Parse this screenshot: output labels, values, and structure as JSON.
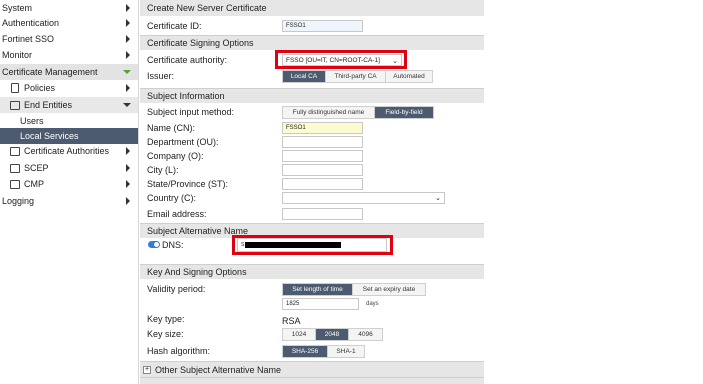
{
  "sidebar": {
    "items": [
      {
        "label": "System"
      },
      {
        "label": "Authentication"
      },
      {
        "label": "Fortinet SSO"
      },
      {
        "label": "Monitor"
      },
      {
        "label": "Certificate Management"
      },
      {
        "label": "Policies"
      },
      {
        "label": "End Entities"
      },
      {
        "label": "Users"
      },
      {
        "label": "Local Services"
      },
      {
        "label": "Certificate Authorities"
      },
      {
        "label": "SCEP"
      },
      {
        "label": "CMP"
      },
      {
        "label": "Logging"
      }
    ]
  },
  "form": {
    "title": "Create New Server Certificate",
    "certificate_id": {
      "label": "Certificate ID:",
      "value": "FSSO1"
    },
    "signing": {
      "header": "Certificate Signing Options",
      "ca_label": "Certificate authority:",
      "ca_value": "FSSO [OU=IT, CN=ROOT-CA-1]",
      "issuer_label": "Issuer:",
      "issuer_options": [
        "Local CA",
        "Third-party CA",
        "Automated"
      ],
      "issuer_selected": "Local CA"
    },
    "subject": {
      "header": "Subject Information",
      "input_method_label": "Subject input method:",
      "input_methods": [
        "Fully distinguished name",
        "Field-by-field"
      ],
      "input_method_selected": "Field-by-field",
      "name_label": "Name (CN):",
      "name_value": "FSSO1",
      "department_label": "Department (OU):",
      "company_label": "Company (O):",
      "city_label": "City (L):",
      "state_label": "State/Province (ST):",
      "country_label": "Country (C):",
      "email_label": "Email address:"
    },
    "san": {
      "header": "Subject Alternative Name",
      "dns_label": "DNS:",
      "dns_prefix": "S"
    },
    "key": {
      "header": "Key And Signing Options",
      "validity_label": "Validity period:",
      "validity_options": [
        "Set length of time",
        "Set an expiry date"
      ],
      "validity_selected": "Set length of time",
      "validity_value": "1825",
      "validity_unit": "days",
      "key_type_label": "Key type:",
      "key_type_value": "RSA",
      "key_size_label": "Key size:",
      "key_sizes": [
        "1024",
        "2048",
        "4096"
      ],
      "key_size_selected": "2048",
      "hash_label": "Hash algorithm:",
      "hash_options": [
        "SHA-256",
        "SHA-1"
      ],
      "hash_selected": "SHA-256"
    },
    "other_san": {
      "header": "Other Subject Alternative Name"
    }
  },
  "colors": {
    "selected": "#4c5b70",
    "highlight_box": "#e00010",
    "accent_green": "#5aa02c",
    "toggle": "#2f7fd6"
  }
}
